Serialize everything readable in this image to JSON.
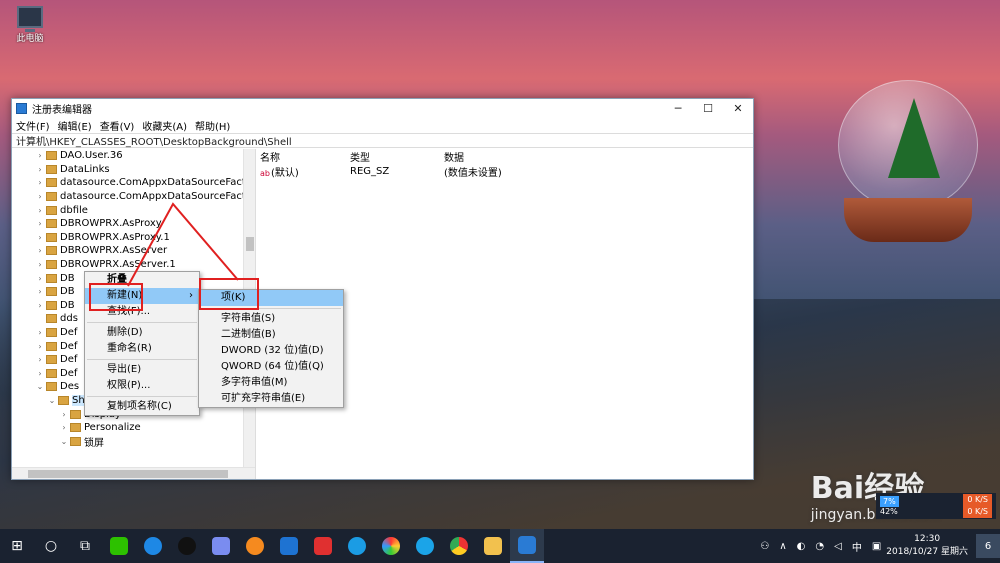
{
  "desktop": {
    "icon_label": "此电脑"
  },
  "window": {
    "title": "注册表编辑器",
    "controls": [
      "─",
      "☐",
      "✕"
    ],
    "menu": [
      "文件(F)",
      "编辑(E)",
      "查看(V)",
      "收藏夹(A)",
      "帮助(H)"
    ],
    "address": "计算机\\HKEY_CLASSES_ROOT\\DesktopBackground\\Shell"
  },
  "tree": {
    "rows": [
      {
        "arrow": "›",
        "label": "DAO.User.36",
        "indent": 1
      },
      {
        "arrow": "›",
        "label": "DataLinks",
        "indent": 1
      },
      {
        "arrow": "›",
        "label": "datasource.ComAppxDataSourceFacto",
        "indent": 1
      },
      {
        "arrow": "›",
        "label": "datasource.ComAppxDataSourceFacto",
        "indent": 1
      },
      {
        "arrow": "›",
        "label": "dbfile",
        "indent": 1
      },
      {
        "arrow": "›",
        "label": "DBROWPRX.AsProxy",
        "indent": 1
      },
      {
        "arrow": "›",
        "label": "DBROWPRX.AsProxy.1",
        "indent": 1
      },
      {
        "arrow": "›",
        "label": "DBROWPRX.AsServer",
        "indent": 1
      },
      {
        "arrow": "›",
        "label": "DBROWPRX.AsServer.1",
        "indent": 1
      },
      {
        "arrow": "›",
        "label": "DB",
        "indent": 1
      },
      {
        "arrow": "›",
        "label": "DB",
        "indent": 1
      },
      {
        "arrow": "›",
        "label": "DB",
        "indent": 1
      },
      {
        "arrow": "",
        "label": "dds",
        "indent": 1
      },
      {
        "arrow": "›",
        "label": "Def",
        "indent": 1
      },
      {
        "arrow": "›",
        "label": "Def",
        "indent": 1
      },
      {
        "arrow": "›",
        "label": "Def",
        "indent": 1
      },
      {
        "arrow": "›",
        "label": "Def",
        "indent": 1
      },
      {
        "arrow": "⌄",
        "label": "Des",
        "indent": 1
      },
      {
        "arrow": "⌄",
        "label": "Shell",
        "indent": 2,
        "selected": true
      },
      {
        "arrow": "›",
        "label": "Display",
        "indent": 3
      },
      {
        "arrow": "›",
        "label": "Personalize",
        "indent": 3
      },
      {
        "arrow": "⌄",
        "label": "锁屏",
        "indent": 3
      }
    ]
  },
  "values": {
    "headers": [
      "名称",
      "类型",
      "数据"
    ],
    "rows": [
      {
        "name": "(默认)",
        "type": "REG_SZ",
        "data": "(数值未设置)"
      }
    ]
  },
  "context_menu": {
    "items": [
      {
        "label": "折叠",
        "bold": true
      },
      {
        "label": "新建(N)",
        "highlight": true,
        "submenu": true
      },
      {
        "label": "查找(F)..."
      },
      {
        "sep": true
      },
      {
        "label": "删除(D)"
      },
      {
        "label": "重命名(R)"
      },
      {
        "sep": true
      },
      {
        "label": "导出(E)"
      },
      {
        "label": "权限(P)..."
      },
      {
        "sep": true
      },
      {
        "label": "复制项名称(C)"
      }
    ]
  },
  "submenu": {
    "items": [
      {
        "label": "项(K)",
        "highlight": true
      },
      {
        "sep": true
      },
      {
        "label": "字符串值(S)"
      },
      {
        "label": "二进制值(B)"
      },
      {
        "label": "DWORD (32 位)值(D)"
      },
      {
        "label": "QWORD (64 位)值(Q)"
      },
      {
        "label": "多字符串值(M)"
      },
      {
        "label": "可扩充字符串值(E)"
      }
    ]
  },
  "taskbar": {
    "tray_lang": "中",
    "time": "12:30",
    "date": "2018/10/27 星期六",
    "notification_count": "6"
  },
  "net_widget": {
    "percent": "7%",
    "percent2": "42%",
    "up": "0 K/S",
    "down": "0 K/S"
  },
  "watermark": {
    "brand": "Bai",
    "brand2": "经验",
    "url": "jingyan.baidu.com"
  },
  "colors": {
    "highlight": "#91c9f7",
    "annotation_red": "#e02020",
    "taskbar": "#1a2230"
  }
}
